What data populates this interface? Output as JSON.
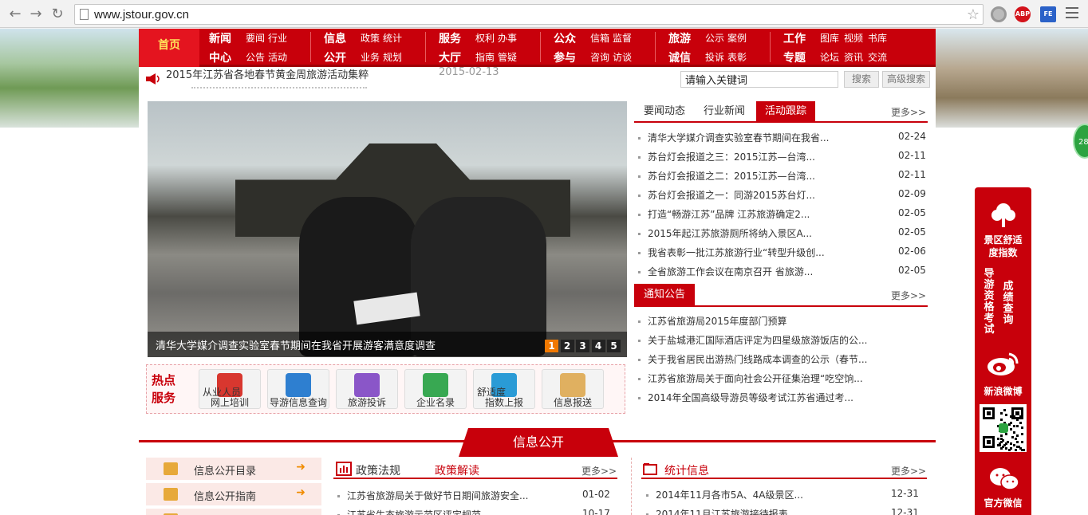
{
  "browser": {
    "url": "www.jstour.gov.cn",
    "ext1": "ABP",
    "ext2": "FE"
  },
  "nav": {
    "home": "首页",
    "groups": [
      {
        "big": [
          "新闻",
          "中心"
        ],
        "subs": [
          [
            "要闻",
            "行业"
          ],
          [
            "公告",
            "活动"
          ]
        ]
      },
      {
        "big": [
          "信息",
          "公开"
        ],
        "subs": [
          [
            "政策",
            "统计"
          ],
          [
            "业务",
            "规划"
          ]
        ]
      },
      {
        "big": [
          "服务",
          "大厅"
        ],
        "subs": [
          [
            "权利",
            "办事"
          ],
          [
            "指南",
            "管疑"
          ]
        ]
      },
      {
        "big": [
          "公众",
          "参与"
        ],
        "subs": [
          [
            "信箱",
            "监督"
          ],
          [
            "咨询",
            "访谈"
          ]
        ]
      },
      {
        "big": [
          "旅游",
          "诚信"
        ],
        "subs": [
          [
            "公示",
            "案例"
          ],
          [
            "投诉",
            "表彰"
          ]
        ]
      },
      {
        "big": [
          "工作",
          "专题"
        ],
        "subs": [
          [
            "图库",
            "视频",
            "书库"
          ],
          [
            "论坛",
            "资讯",
            "交流"
          ]
        ]
      }
    ]
  },
  "notice": {
    "title": "2015年江苏省各地春节黄金周旅游活动集粹",
    "date": "2015-02-13"
  },
  "search": {
    "placeholder": "请输入关键词",
    "btn": "搜索",
    "adv": "高级搜索"
  },
  "slideshow": {
    "caption": "清华大学媒介调查实验室春节期间在我省开展游客满意度调查",
    "pages": [
      "1",
      "2",
      "3",
      "4",
      "5"
    ]
  },
  "hot": {
    "label1": "热点",
    "label2": "服务",
    "items": [
      {
        "l1": "从业人员",
        "l2": "网上培训",
        "color": "#d8372f"
      },
      {
        "l1": "",
        "l2": "导游信息查询",
        "color": "#2e7fd0"
      },
      {
        "l1": "",
        "l2": "旅游投诉",
        "color": "#8a56c8"
      },
      {
        "l1": "",
        "l2": "企业名录",
        "color": "#38a852"
      },
      {
        "l1": "舒适度",
        "l2": "指数上报",
        "color": "#2a9bd6"
      },
      {
        "l1": "",
        "l2": "信息报送",
        "color": "#e0b060"
      }
    ]
  },
  "news_tabs": [
    "要闻动态",
    "行业新闻",
    "活动跟踪"
  ],
  "more": "更多>>",
  "news": [
    {
      "t": "清华大学媒介调查实验室春节期间在我省...",
      "d": "02-24"
    },
    {
      "t": "苏台灯会报道之三：2015江苏—台湾...",
      "d": "02-11"
    },
    {
      "t": "苏台灯会报道之二：2015江苏—台湾...",
      "d": "02-11"
    },
    {
      "t": "苏台灯会报道之一：同游2015苏台灯...",
      "d": "02-09"
    },
    {
      "t": "打造“畅游江苏”品牌 江苏旅游确定2...",
      "d": "02-05"
    },
    {
      "t": "2015年起江苏旅游厕所将纳入景区A...",
      "d": "02-05"
    },
    {
      "t": "我省表彰一批江苏旅游行业“转型升级创...",
      "d": "02-06"
    },
    {
      "t": "全省旅游工作会议在南京召开 省旅游...",
      "d": "02-05"
    }
  ],
  "notices_tab": "通知公告",
  "notices": [
    "江苏省旅游局2015年度部门预算",
    "关于盐城港汇国际酒店评定为四星级旅游饭店的公...",
    "关于我省居民出游热门线路成本调查的公示（春节...",
    "江苏省旅游局关于面向社会公开征集治理“吃空饷...",
    "2014年全国高级导游员等级考试江苏省通过考..."
  ],
  "float": {
    "item1": "景区舒适度指数",
    "item2a": "导游资格考试",
    "item2b": "成绩查询",
    "weibo": "新浪微博",
    "weixin": "官方微信",
    "ball": "28"
  },
  "info": {
    "title": "信息公开",
    "left": [
      {
        "t": "信息公开目录"
      },
      {
        "t": "信息公开指南"
      },
      {
        "t": ""
      }
    ],
    "policy_tabs": [
      "政策法规",
      "政策解读"
    ],
    "policy": [
      {
        "t": "江苏省旅游局关于做好节日期间旅游安全...",
        "d": "01-02"
      },
      {
        "t": "江苏省生态旅游示范区评定规范",
        "d": "10-17"
      }
    ],
    "stat_tab": "统计信息",
    "stats": [
      {
        "t": "2014年11月各市5A、4A级景区...",
        "d": "12-31"
      },
      {
        "t": "2014年11月江苏旅游接待报表",
        "d": "12-31"
      }
    ]
  }
}
